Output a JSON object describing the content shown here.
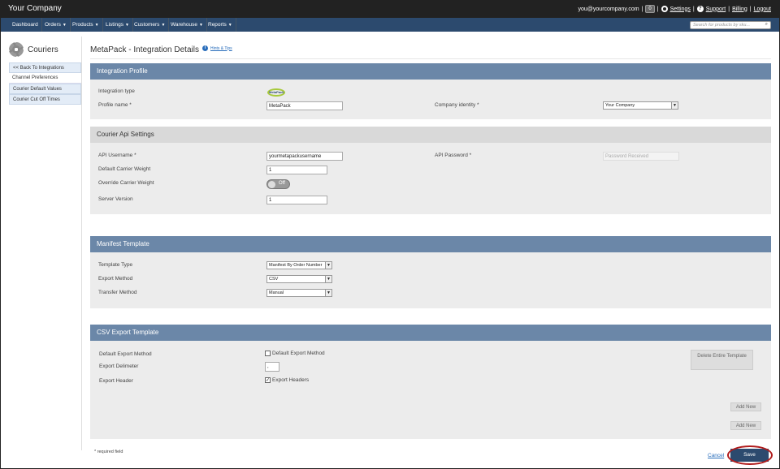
{
  "app": {
    "brand": "Your Company"
  },
  "topbar": {
    "email": "you@yourcompany.com",
    "sep": "|",
    "notif_count": "0",
    "settings": "Settings",
    "support": "Support",
    "billing": "Billing",
    "logout": "Logout"
  },
  "nav": {
    "items": [
      "Dashboard",
      "Orders",
      "Products",
      "Listings",
      "Customers",
      "Warehouse",
      "Reports"
    ],
    "search_placeholder": "Search for products by sku..."
  },
  "sidebar": {
    "title": "Couriers",
    "items": [
      "<< Back To Integrations",
      "Channel Preferences",
      "Courier Default Values",
      "Courier Cut Off Times"
    ]
  },
  "page": {
    "title": "MetaPack - Integration Details",
    "hint": "Hints & Tips"
  },
  "integration_profile": {
    "header": "Integration Profile",
    "type_label": "Integration type",
    "logo_text": "MetaPack",
    "profile_name_label": "Profile name *",
    "profile_name_value": "MetaPack",
    "company_identity_label": "Company identity *",
    "company_identity_value": "Your Company"
  },
  "courier_api": {
    "header": "Courier Api Settings",
    "username_label": "API Username *",
    "username_value": "yourmetapackusername",
    "password_label": "API Password *",
    "password_placeholder": "Password Received",
    "weight_label": "Default Carrier Weight",
    "weight_value": "1",
    "override_label": "Override Carrier Weight",
    "override_state": "Off",
    "server_label": "Server Version",
    "server_value": "1"
  },
  "manifest": {
    "header": "Manifest Template",
    "template_type_label": "Template Type",
    "template_type_value": "Manifest By Order Number",
    "export_method_label": "Export Method",
    "export_method_value": "CSV",
    "transfer_method_label": "Transfer Method",
    "transfer_method_value": "Manual"
  },
  "csv_export": {
    "header": "CSV Export Template",
    "default_export_label": "Default Export Method",
    "default_export_check": "Default Export Method",
    "default_export_checked": false,
    "delimiter_label": "Export Delimeter",
    "delimiter_value": ",",
    "header_label": "Export Header",
    "header_check": "Export Headers",
    "header_checked": true,
    "delete_button": "Delete Entire Template",
    "add_new_1": "Add New",
    "add_new_2": "Add New"
  },
  "footer": {
    "required_note": "* required field",
    "cancel": "Cancel",
    "save": "Save"
  },
  "colors": {
    "topbar": "#222222",
    "nav": "#2c4a6e",
    "panel_header": "#6b87a8",
    "save_highlight": "#b01c1c"
  },
  "icons": {
    "settings": "gear-icon",
    "help": "question-icon",
    "search": "search-icon",
    "sidebar": "gear-icon",
    "hint": "info-icon"
  }
}
